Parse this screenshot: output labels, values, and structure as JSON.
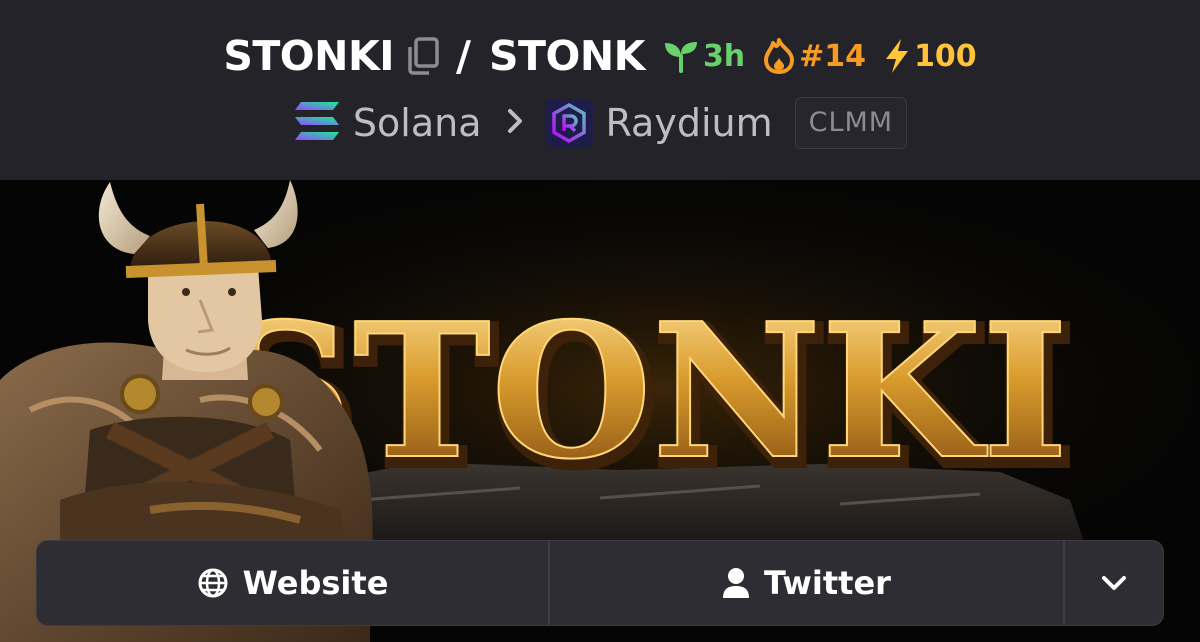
{
  "header": {
    "base_symbol": "STONKI",
    "separator": "/",
    "quote_symbol": "STONK",
    "age": "3h",
    "rank": "#14",
    "boosts": "100"
  },
  "chain": {
    "name": "Solana",
    "dex": "Raydium",
    "pool_type": "CLMM"
  },
  "banner": {
    "text": "STONKI"
  },
  "links": {
    "website_label": "Website",
    "twitter_label": "Twitter"
  },
  "colors": {
    "age": "#69d16b",
    "rank": "#f59a23",
    "boosts": "#ffc43a",
    "header_bg": "#24232a",
    "button_bg": "#2e2d34"
  },
  "icons": {
    "copy": "copy-icon",
    "age": "seedling-icon",
    "rank": "flame-icon",
    "boosts": "lightning-icon",
    "chain": "solana-logo",
    "dex": "raydium-logo",
    "website": "globe-icon",
    "twitter": "user-icon",
    "more": "chevron-down-icon"
  }
}
